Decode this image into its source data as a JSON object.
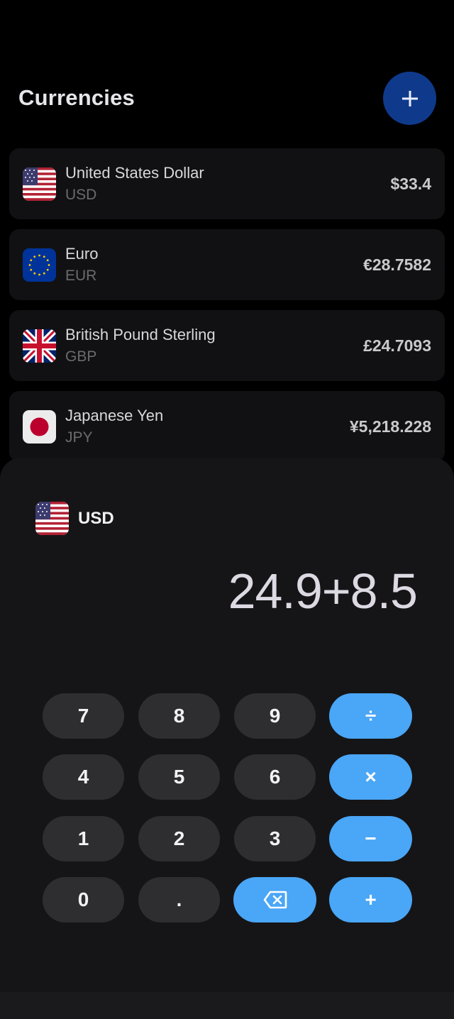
{
  "header": {
    "title": "Currencies",
    "add_icon": "plus-icon"
  },
  "currencies": [
    {
      "name": "United States Dollar",
      "code": "USD",
      "amount": "$33.4",
      "flag": "us-flag-icon"
    },
    {
      "name": "Euro",
      "code": "EUR",
      "amount": "€28.7582",
      "flag": "eu-flag-icon"
    },
    {
      "name": "British Pound Sterling",
      "code": "GBP",
      "amount": "£24.7093",
      "flag": "uk-flag-icon"
    },
    {
      "name": "Japanese Yen",
      "code": "JPY",
      "amount": "¥5,218.228",
      "flag": "jp-flag-icon"
    }
  ],
  "calculator": {
    "base_code": "USD",
    "base_flag": "us-flag-icon",
    "expression": "24.9+8.5",
    "keys": {
      "k7": "7",
      "k8": "8",
      "k9": "9",
      "div": "÷",
      "k4": "4",
      "k5": "5",
      "k6": "6",
      "mul": "×",
      "k1": "1",
      "k2": "2",
      "k3": "3",
      "sub": "−",
      "k0": "0",
      "dot": ".",
      "backspace_icon": "backspace-icon",
      "add": "+"
    }
  },
  "colors": {
    "accent": "#4aa6f6",
    "add_button": "#0f3a8c",
    "card": "#111113",
    "sheet": "#151517"
  }
}
